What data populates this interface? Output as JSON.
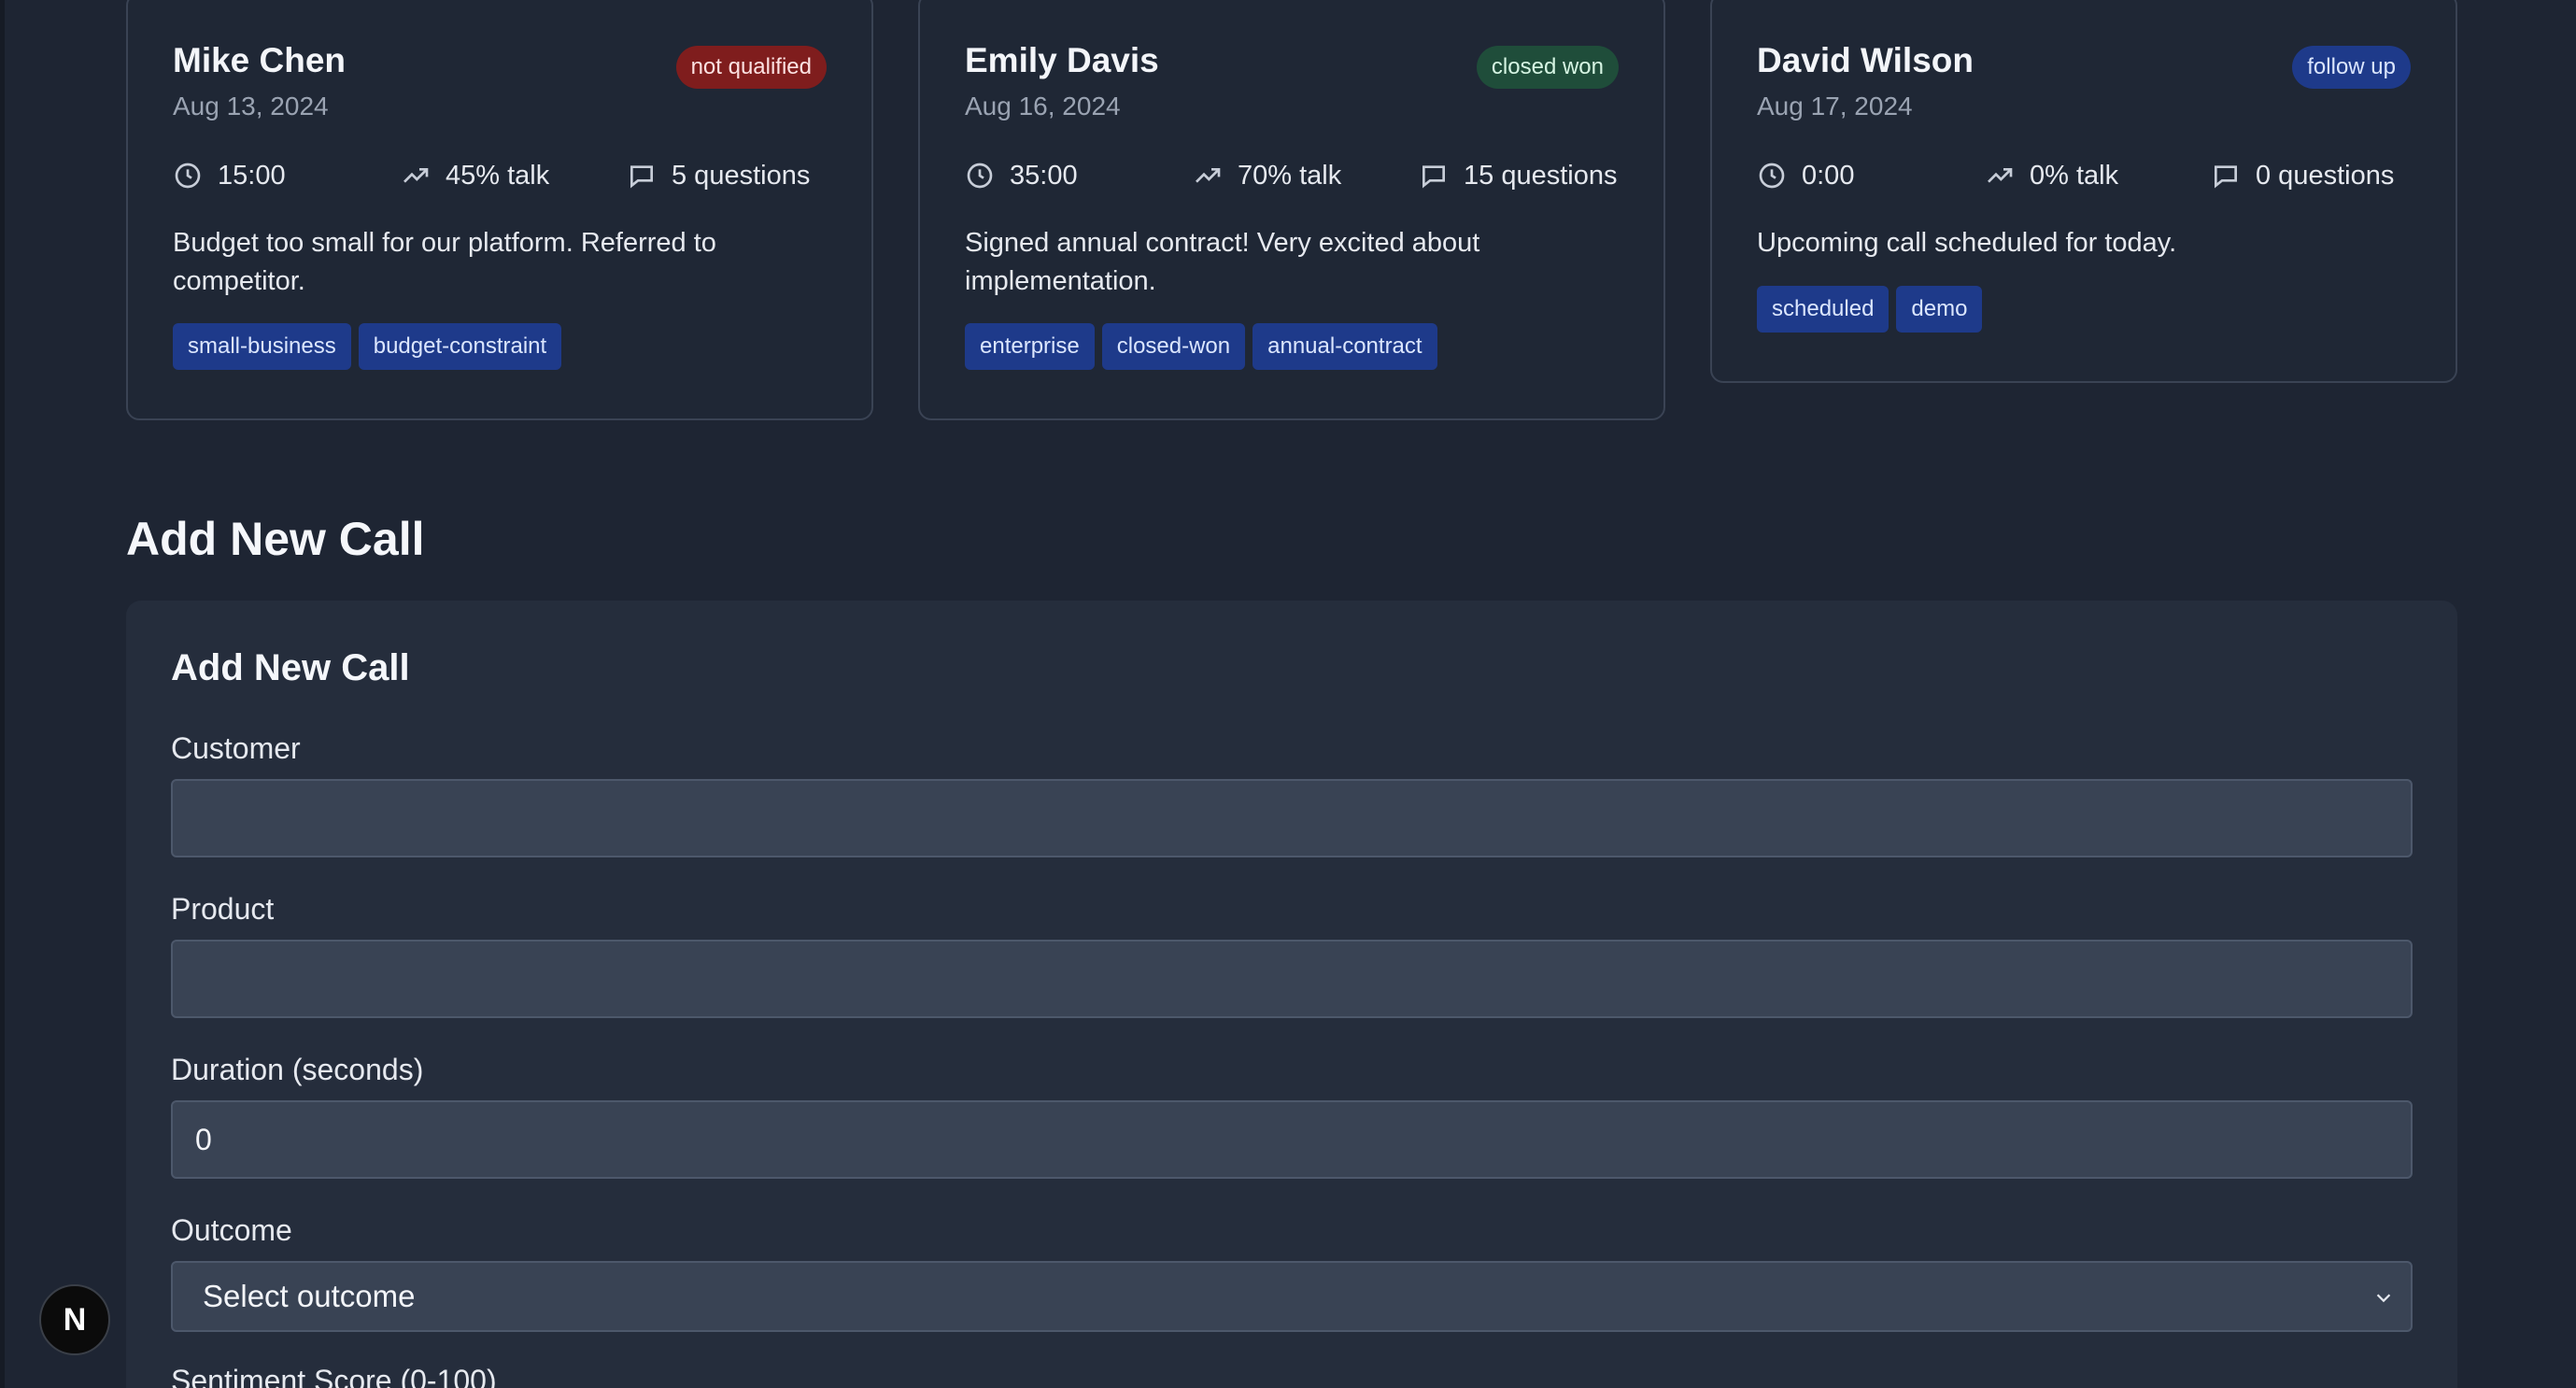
{
  "calls": [
    {
      "name": "Mike Chen",
      "date": "Aug 13, 2024",
      "status": "not qualified",
      "duration": "15:00",
      "talk": "45% talk",
      "questions": "5 questions",
      "summary": "Budget too small for our platform. Referred to competitor.",
      "tags": [
        "small-business",
        "budget-constraint"
      ]
    },
    {
      "name": "Emily Davis",
      "date": "Aug 16, 2024",
      "status": "closed won",
      "duration": "35:00",
      "talk": "70% talk",
      "questions": "15 questions",
      "summary": "Signed annual contract! Very excited about implementation.",
      "tags": [
        "enterprise",
        "closed-won",
        "annual-contract"
      ]
    },
    {
      "name": "David Wilson",
      "date": "Aug 17, 2024",
      "status": "follow up",
      "duration": "0:00",
      "talk": "0% talk",
      "questions": "0 questions",
      "summary": "Upcoming call scheduled for today.",
      "tags": [
        "scheduled",
        "demo"
      ]
    }
  ],
  "section_title": "Add New Call",
  "form": {
    "title": "Add New Call",
    "customer_label": "Customer",
    "customer_value": "",
    "product_label": "Product",
    "product_value": "",
    "duration_label": "Duration (seconds)",
    "duration_value": "0",
    "outcome_label": "Outcome",
    "outcome_selected": "Select outcome",
    "sentiment_label": "Sentiment Score (0-100)"
  },
  "nextjs_badge": "N",
  "colors": {
    "background": "#1e2533",
    "card": "#1f2735",
    "badge_red": "#7f1d1d",
    "badge_green": "#1f4d3a",
    "badge_blue": "#1e3a8a",
    "input": "#394354"
  }
}
